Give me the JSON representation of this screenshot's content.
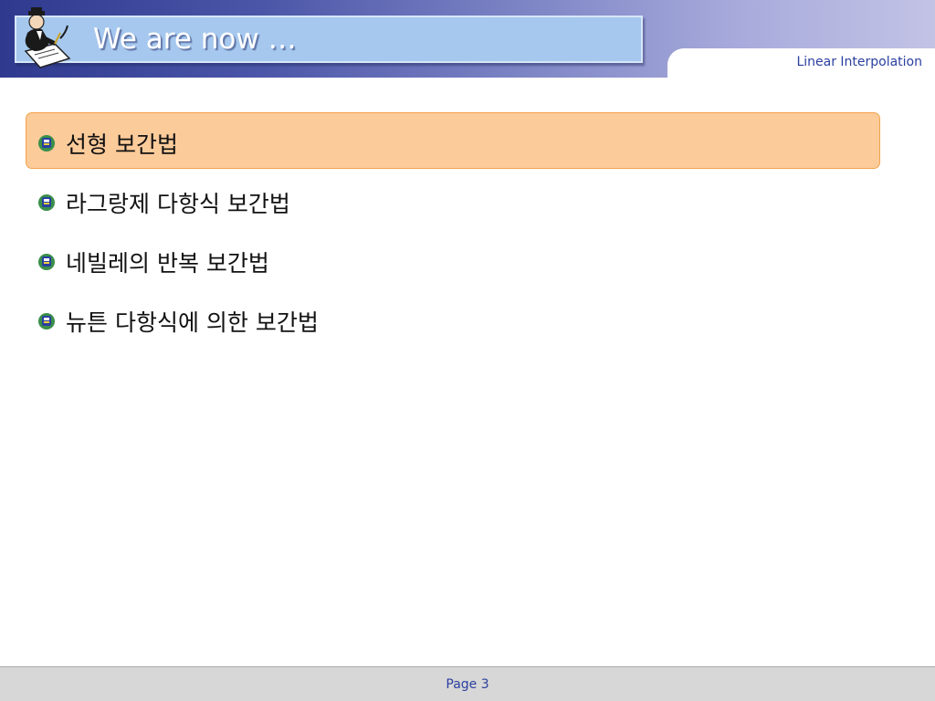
{
  "header": {
    "title": "We are now …",
    "subtitle_tab": "Linear Interpolation",
    "logo_icon": "writer-at-desk-icon",
    "accent_color": "#2f3a8f"
  },
  "content": {
    "items": [
      {
        "label": "선형 보간법",
        "highlighted": true
      },
      {
        "label": "라그랑제 다항식 보간법",
        "highlighted": false
      },
      {
        "label": "네빌레의 반복 보간법",
        "highlighted": false
      },
      {
        "label": "뉴튼 다항식에 의한 보간법",
        "highlighted": false
      }
    ],
    "bullet_icon": "crest-bullet-icon",
    "highlight_color": "#fccb9a"
  },
  "footer": {
    "page_label": "Page 3"
  }
}
